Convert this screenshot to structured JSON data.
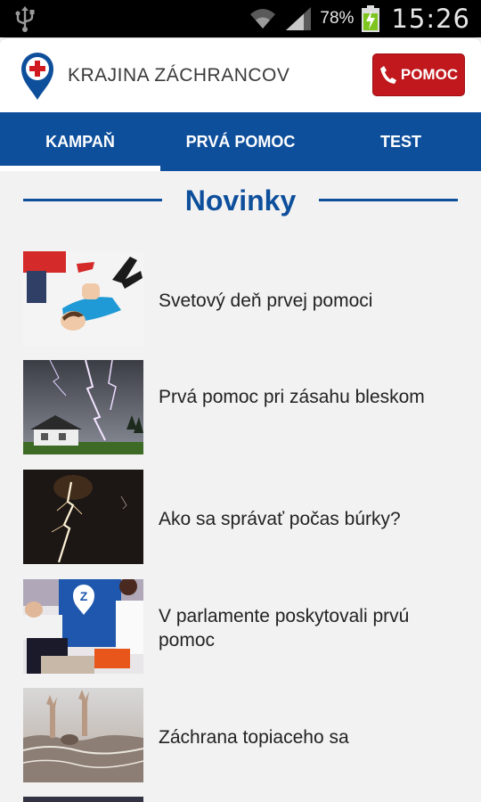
{
  "status_bar": {
    "battery_percent": "78%",
    "time": "15:26"
  },
  "app_bar": {
    "title": "KRAJINA ZÁCHRANCOV",
    "help_button_label": "POMOC"
  },
  "tabs": [
    {
      "label": "KAMPAŇ",
      "active": true
    },
    {
      "label": "PRVÁ POMOC",
      "active": false
    },
    {
      "label": "TEST",
      "active": false
    }
  ],
  "section": {
    "title": "Novinky"
  },
  "news": [
    {
      "title": "Svetový deň prvej pomoci",
      "image": "cpr-illustration"
    },
    {
      "title": "Prvá pomoc pri zásahu bleskom",
      "image": "lightning-house"
    },
    {
      "title": "Ako sa správať počas búrky?",
      "image": "lightning-night"
    },
    {
      "title": "V parlamente poskytovali prvú pomoc",
      "image": "parliament-first-aid"
    },
    {
      "title": "Záchrana topiaceho sa",
      "image": "drowning-hand"
    }
  ],
  "colors": {
    "primary_blue": "#0e4f9c",
    "help_red": "#c0181c",
    "background": "#f2f2f2"
  }
}
